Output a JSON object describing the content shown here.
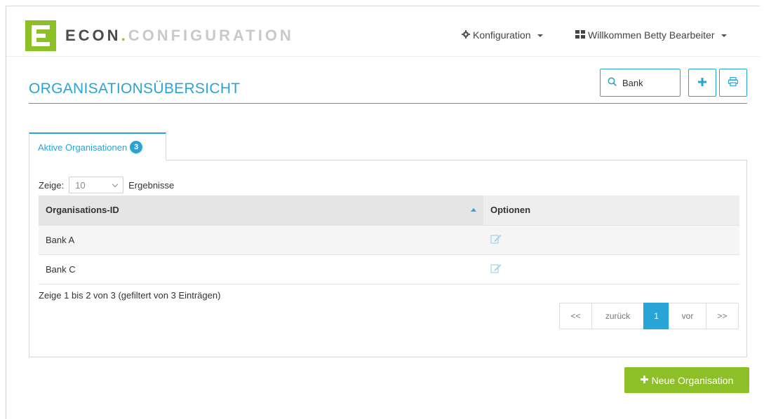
{
  "header": {
    "brand_part1": "ECON",
    "brand_dot": ".",
    "brand_part2": "CONFIGURATION",
    "nav_konfiguration": "Konfiguration",
    "nav_user": "Willkommen Betty Bearbeiter",
    "logo_icon": "econ-logo-e",
    "konfig_icon": "gear-icon",
    "user_icon": "grid-icon"
  },
  "page": {
    "title": "ORGANISATIONSÜBERSICHT",
    "search_value": "Bank",
    "search_icon": "search-icon",
    "add_icon": "plus-icon",
    "print_icon": "print-icon"
  },
  "tab": {
    "label": "Aktive Organisationen",
    "count": "3"
  },
  "table": {
    "length_prefix": "Zeige:",
    "length_value": "10",
    "length_suffix": "Ergebnisse",
    "columns": [
      "Organisations-ID",
      "Optionen"
    ],
    "rows": [
      {
        "id": "Bank A",
        "option_icon": "edit-icon"
      },
      {
        "id": "Bank C",
        "option_icon": "edit-icon"
      }
    ],
    "info": "Zeige 1 bis 2 von 3 (gefiltert von 3 Einträgen)"
  },
  "pagination": {
    "first": "<<",
    "prev": "zurück",
    "current": "1",
    "next": "vor",
    "last": ">>"
  },
  "actions": {
    "new_org_label": "Neue Organisation"
  },
  "colors": {
    "accent_blue": "#29a4d6",
    "brand_green": "#8cc026"
  }
}
